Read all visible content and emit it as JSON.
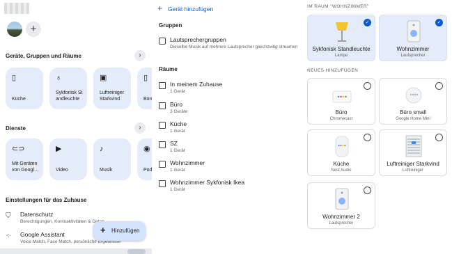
{
  "left": {
    "sections": {
      "devices_title": "Geräte, Gruppen und Räume",
      "services_title": "Dienste",
      "settings_title": "Einstellungen für das Zuhause"
    },
    "device_tiles": [
      {
        "icon": "speaker-icon",
        "label": "Küche"
      },
      {
        "icon": "lamp-icon",
        "label": "Sykfonisk St andleuchte"
      },
      {
        "icon": "air-purifier-icon",
        "label": "Luftreiniger Starkvind"
      },
      {
        "icon": "speaker-icon",
        "label": "Büro"
      }
    ],
    "service_tiles": [
      {
        "icon": "link-icon",
        "label": "Mit Geräten von Googl…"
      },
      {
        "icon": "video-icon",
        "label": "Video"
      },
      {
        "icon": "music-icon",
        "label": "Musik"
      },
      {
        "icon": "podcast-icon",
        "label": "Pod"
      }
    ],
    "settings": [
      {
        "icon": "shield-icon",
        "title": "Datenschutz",
        "subtitle": "Berechtigungen, Kontoaktivitäten & Daten"
      },
      {
        "icon": "assistant-icon",
        "title": "Google Assistant",
        "subtitle": "Voice Match, Face Match, persönliche Ergebnisse"
      }
    ],
    "fab_label": "Hinzufügen"
  },
  "middle": {
    "add_device": "Gerät hinzufügen",
    "groups_title": "Gruppen",
    "group": {
      "title": "Lautsprechergruppen",
      "subtitle": "Dieselbe Musik auf mehrere Lautsprecher gleichzeitig streamen"
    },
    "rooms_title": "Räume",
    "rooms": [
      {
        "title": "In meinem Zuhause",
        "subtitle": "1 Gerät"
      },
      {
        "title": "Büro",
        "subtitle": "3 Geräte"
      },
      {
        "title": "Küche",
        "subtitle": "1 Gerät"
      },
      {
        "title": "SZ",
        "subtitle": "1 Gerät"
      },
      {
        "title": "Wohnzimmer",
        "subtitle": "1 Gerät"
      },
      {
        "title": "Wohnzimmer Sykfonisk Ikea",
        "subtitle": "1 Gerät"
      }
    ]
  },
  "right": {
    "in_room_title": "IM RAUM \"WOHNZIMMER\"",
    "new_title": "NEUES HINZUFÜGEN",
    "in_room": [
      {
        "name": "Sykfonisk Standleuchte",
        "sub": "Lampe",
        "selected": true
      },
      {
        "name": "Wohnzimmer",
        "sub": "Lautsprecher",
        "selected": true
      }
    ],
    "new_devices": [
      {
        "name": "Büro",
        "sub": "Chromecast",
        "selected": false
      },
      {
        "name": "Büro small",
        "sub": "Google Home Mini",
        "selected": false
      },
      {
        "name": "Küche",
        "sub": "Nest Audio",
        "selected": false
      },
      {
        "name": "Luftreiniger Starkvind",
        "sub": "Luftreiniger",
        "selected": false
      },
      {
        "name": "Wohnzimmer 2",
        "sub": "Lautsprecher",
        "selected": false
      }
    ]
  },
  "colors": {
    "accent": "#0b57d0",
    "tile_bg": "#e4ecf9",
    "fab_bg": "#d3e3fd"
  }
}
